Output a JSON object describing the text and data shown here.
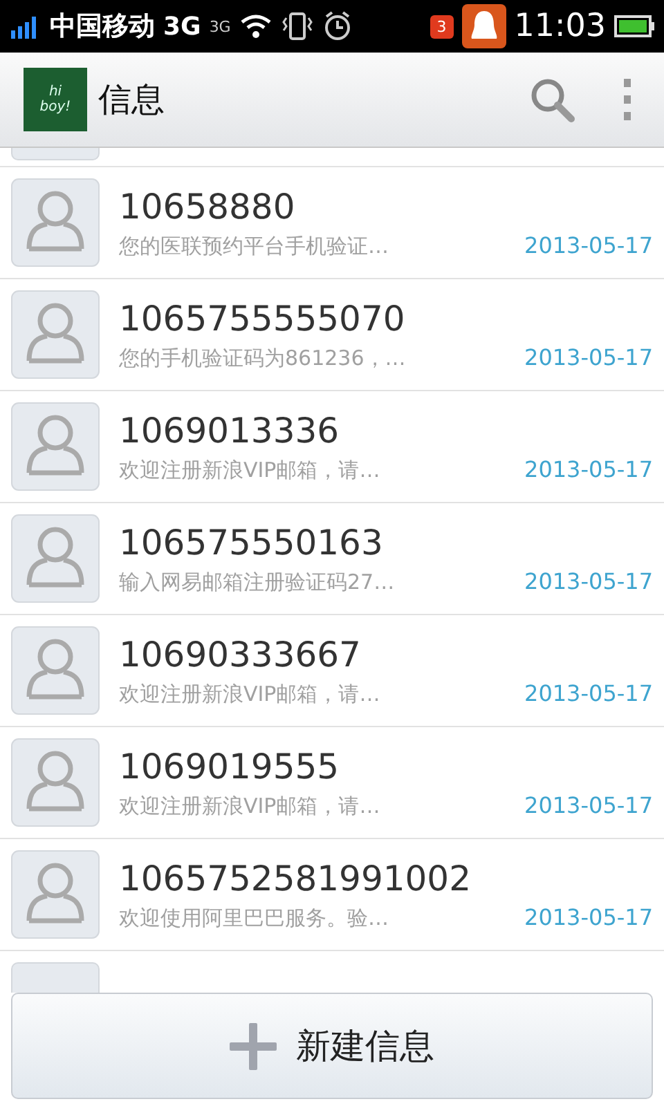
{
  "status_bar": {
    "carrier": "中国移动",
    "network": "3G",
    "network_small": "3G",
    "notification_count": "3",
    "time": "11:03"
  },
  "action_bar": {
    "logo_text": "hi boy!",
    "title": "信息"
  },
  "conversations": [
    {
      "sender": "10658880",
      "snippet": "您的医联预约平台手机验证…",
      "date": "2013-05-17"
    },
    {
      "sender": "1065755555070",
      "snippet": "您的手机验证码为861236，…",
      "date": "2013-05-17"
    },
    {
      "sender": "1069013336",
      "snippet": "欢迎注册新浪VIP邮箱，请…",
      "date": "2013-05-17"
    },
    {
      "sender": "106575550163",
      "snippet": "输入网易邮箱注册验证码27…",
      "date": "2013-05-17"
    },
    {
      "sender": "10690333667",
      "snippet": "欢迎注册新浪VIP邮箱，请…",
      "date": "2013-05-17"
    },
    {
      "sender": "1069019555",
      "snippet": "欢迎注册新浪VIP邮箱，请…",
      "date": "2013-05-17"
    },
    {
      "sender": "1065752581991002",
      "snippet": "欢迎使用阿里巴巴服务。验…",
      "date": "2013-05-17"
    }
  ],
  "compose_button": {
    "label": "新建信息"
  }
}
